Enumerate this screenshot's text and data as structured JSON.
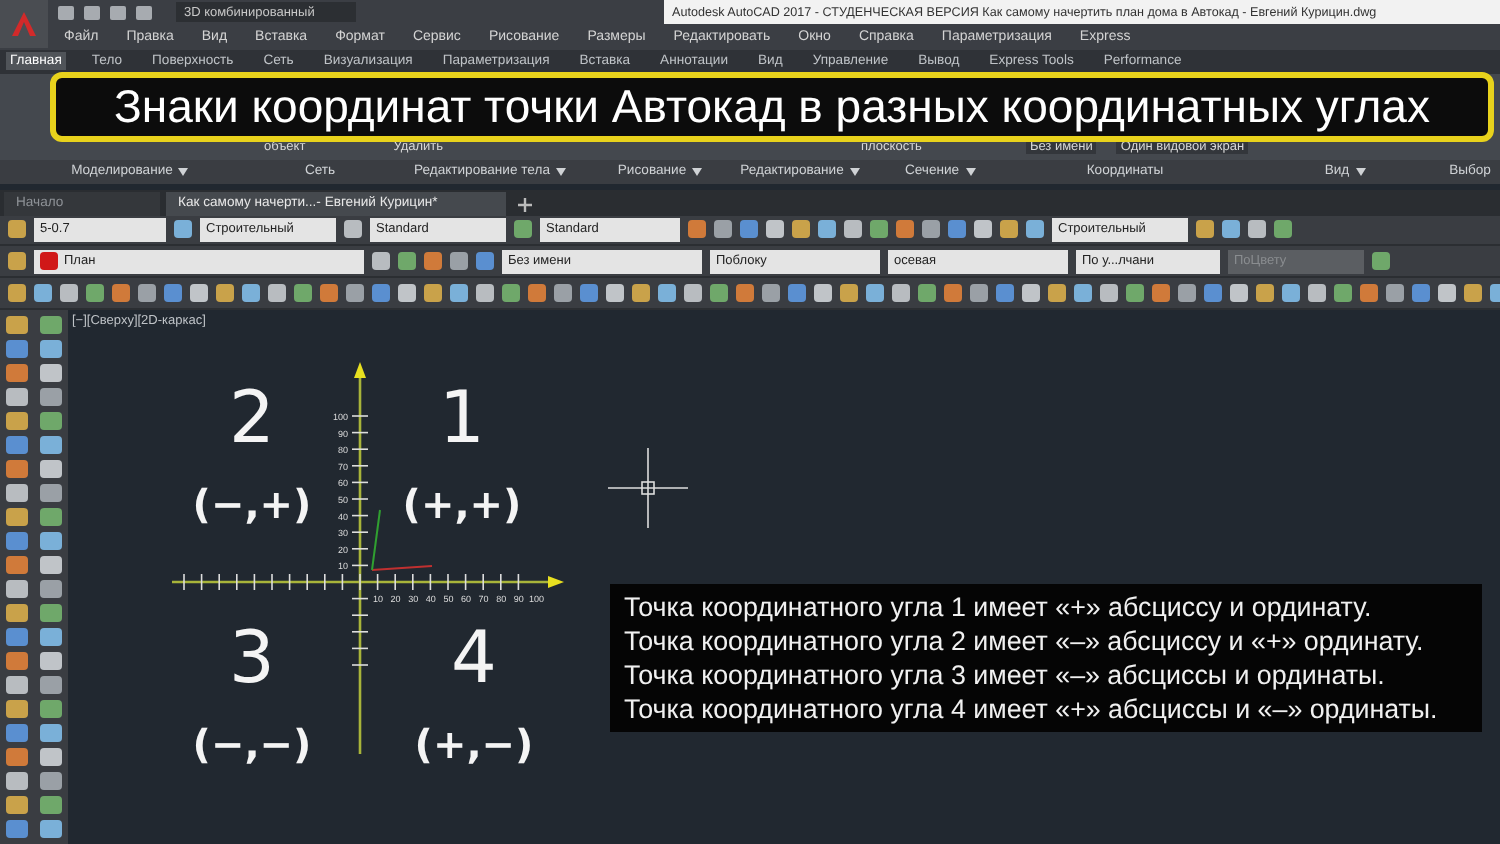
{
  "title_bar": {
    "workspace": "3D комбинированный",
    "title": "Autodesk AutoCAD 2017 - СТУДЕНЧЕСКАЯ ВЕРСИЯ    Как самому начертить план дома в Автокад - Евгений Курицин.dwg"
  },
  "menu_bar": [
    "Файл",
    "Правка",
    "Вид",
    "Вставка",
    "Формат",
    "Сервис",
    "Рисование",
    "Размеры",
    "Редактировать",
    "Окно",
    "Справка",
    "Параметризация",
    "Express"
  ],
  "ribbon_tabs": [
    {
      "label": "Главная",
      "selected": true
    },
    {
      "label": "Тело",
      "selected": false
    },
    {
      "label": "Поверхность",
      "selected": false
    },
    {
      "label": "Сеть",
      "selected": false
    },
    {
      "label": "Визуализация",
      "selected": false
    },
    {
      "label": "Параметризация",
      "selected": false
    },
    {
      "label": "Вставка",
      "selected": false
    },
    {
      "label": "Аннотации",
      "selected": false
    },
    {
      "label": "Вид",
      "selected": false
    },
    {
      "label": "Управление",
      "selected": false
    },
    {
      "label": "Вывод",
      "selected": false
    },
    {
      "label": "Express Tools",
      "selected": false
    },
    {
      "label": "Performance",
      "selected": false
    }
  ],
  "banner": "Знаки координат точки Автокад в разных координатных углах",
  "ribbon_controls": [
    {
      "kind": "button",
      "label": "объект"
    },
    {
      "kind": "button",
      "label": "Удалить"
    },
    {
      "kind": "button",
      "label": "плоскость"
    },
    {
      "kind": "dropdown",
      "label": "Без имени"
    },
    {
      "kind": "dropdown",
      "label": "Один видовой экран"
    }
  ],
  "ribbon_panels": [
    {
      "label": "Моделирование",
      "menu": true
    },
    {
      "label": "Сеть",
      "menu": false
    },
    {
      "label": "Редактирование тела",
      "menu": true
    },
    {
      "label": "Рисование",
      "menu": true
    },
    {
      "label": "Редактирование",
      "menu": true
    },
    {
      "label": "Сечение",
      "menu": true
    },
    {
      "label": "Координаты",
      "menu": false
    },
    {
      "label": "Вид",
      "menu": true
    },
    {
      "label": "Выбор",
      "menu": false
    }
  ],
  "file_tabs": [
    {
      "label": "Начало",
      "selected": false
    },
    {
      "label": "Как самому начерти...- Евгений Курицин*",
      "selected": true
    }
  ],
  "toolbar_row_1": [
    {
      "value": "5-0.7"
    },
    {
      "value": "Строительный"
    },
    {
      "value": "Standard"
    },
    {
      "value": "Standard"
    },
    {
      "value": "Строительный"
    }
  ],
  "toolbar_row_2": [
    {
      "value": "План",
      "disabled": false
    },
    {
      "value": "Без имени",
      "disabled": false
    },
    {
      "value": "Поблоку",
      "disabled": false
    },
    {
      "value": "осевая",
      "disabled": false
    },
    {
      "value": "По у...лчани",
      "disabled": false
    },
    {
      "value": "ПоЦвету",
      "disabled": true
    }
  ],
  "viewport_label": "[−][Сверху][2D-каркас]",
  "axis": {
    "y_ticks": [
      "100",
      "90",
      "80",
      "70",
      "60",
      "50",
      "40",
      "30",
      "20",
      "10"
    ],
    "x_ticks": [
      "10",
      "20",
      "30",
      "40",
      "50",
      "60",
      "70",
      "80",
      "90",
      "100"
    ]
  },
  "quadrants": [
    {
      "number": "2",
      "signs": "(−,+)"
    },
    {
      "number": "1",
      "signs": "(+,+)"
    },
    {
      "number": "3",
      "signs": "(−,−)"
    },
    {
      "number": "4",
      "signs": "(+,−)"
    }
  ],
  "notes": [
    "Точка координатного угла 1 имеет «+» абсциссу и ординату.",
    "Точка координатного угла 2 имеет «–» абсциссу и «+» ординату.",
    "Точка координатного угла 3 имеет «–» абсциссы и ординаты.",
    "Точка координатного угла 4 имеет «+» абсциссы и «–» ординаты."
  ]
}
